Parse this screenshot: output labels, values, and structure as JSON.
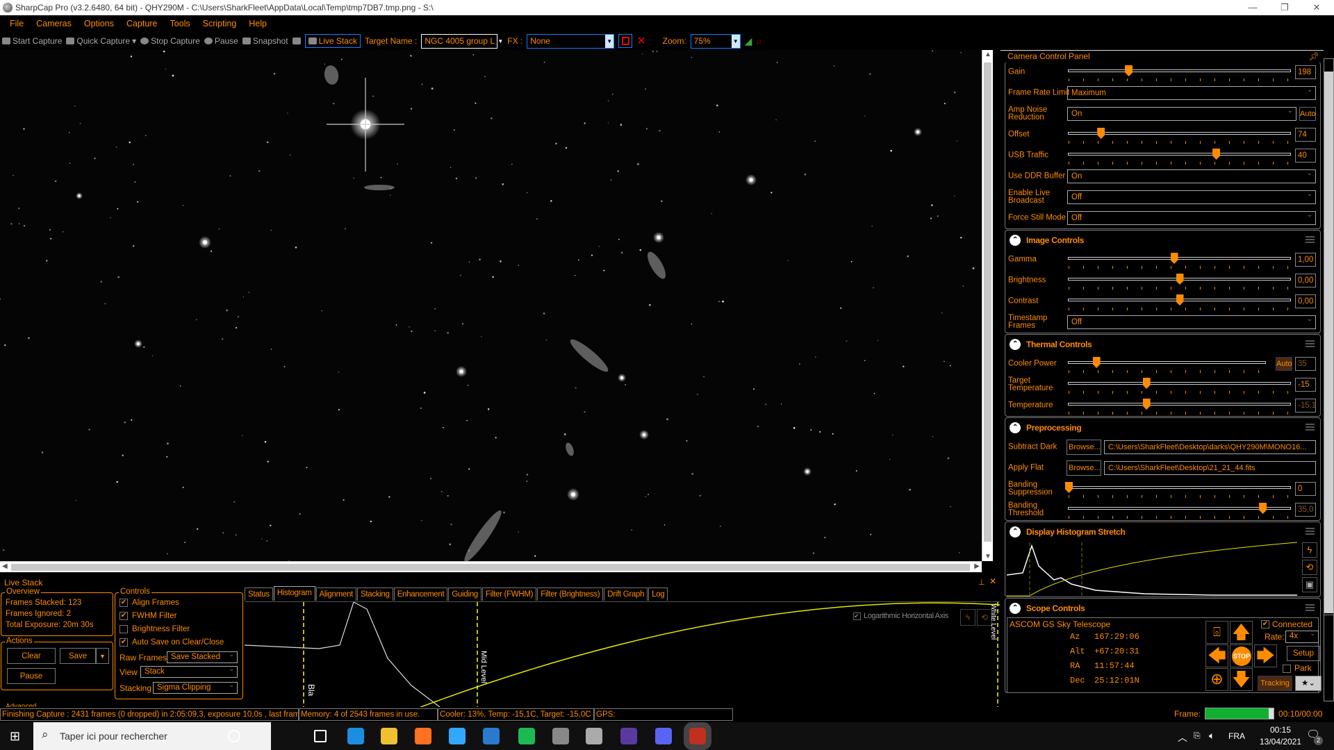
{
  "window": {
    "title": "SharpCap Pro (v3.2.6480, 64 bit) - QHY290M - C:\\Users\\SharkFleet\\AppData\\Local\\Temp\\tmp7DB7.tmp.png - S:\\",
    "min": "—",
    "max": "❐",
    "close": "✕"
  },
  "menu": [
    "File",
    "Cameras",
    "Options",
    "Capture",
    "Tools",
    "Scripting",
    "Help"
  ],
  "toolbar": {
    "start_capture": "Start Capture",
    "quick_capture": "Quick Capture",
    "stop_capture": "Stop Capture",
    "pause": "Pause",
    "snapshot": "Snapshot",
    "live_stack": "Live Stack",
    "target_label": "Target Name :",
    "target_value": "NGC 4005 group L",
    "fx_label": "FX :",
    "fx_value": "None",
    "zoom_label": "Zoom:",
    "zoom_value": "75%"
  },
  "camera_panel": {
    "title": "Camera Control Panel",
    "rows": [
      {
        "type": "slider",
        "label": "Gain",
        "value": "198",
        "pos": 0.27
      },
      {
        "type": "select",
        "label": "Frame Rate Limit",
        "value": "Maximum"
      },
      {
        "type": "select",
        "label": "Amp Noise Reduction",
        "value": "On",
        "extra": "Auto"
      },
      {
        "type": "slider",
        "label": "Offset",
        "value": "74",
        "pos": 0.145
      },
      {
        "type": "slider",
        "label": "USB Traffic",
        "value": "40",
        "pos": 0.665
      },
      {
        "type": "select",
        "label": "Use DDR Buffer",
        "value": "On"
      },
      {
        "type": "select",
        "label": "Enable Live Broadcast",
        "value": "Off"
      },
      {
        "type": "select",
        "label": "Force Still Mode",
        "value": "Off"
      }
    ]
  },
  "image_controls": {
    "title": "Image Controls",
    "rows": [
      {
        "type": "slider",
        "label": "Gamma",
        "value": "1,00",
        "pos": 0.475
      },
      {
        "type": "slider",
        "label": "Brightness",
        "value": "0,00",
        "pos": 0.5
      },
      {
        "type": "slider",
        "label": "Contrast",
        "value": "0,00",
        "pos": 0.5
      },
      {
        "type": "select",
        "label": "Timestamp Frames",
        "value": "Off"
      }
    ]
  },
  "thermal_controls": {
    "title": "Thermal Controls",
    "rows": [
      {
        "type": "slider",
        "label": "Cooler Power",
        "value": "35",
        "pos": 0.14,
        "dim": true,
        "extra": "Auto"
      },
      {
        "type": "slider",
        "label": "Target Temperature",
        "value": "-15",
        "pos": 0.35
      },
      {
        "type": "slider",
        "label": "Temperature",
        "value": "-15,1",
        "pos": 0.35,
        "dim": true
      }
    ]
  },
  "preprocessing": {
    "title": "Preprocessing",
    "rows": [
      {
        "type": "file",
        "label": "Subtract Dark",
        "button": "Browse...",
        "value": "C:\\Users\\SharkFleet\\Desktop\\darks\\QHY290M\\MONO16..."
      },
      {
        "type": "file",
        "label": "Apply Flat",
        "button": "Browse...",
        "value": "C:\\Users\\SharkFleet\\Desktop\\21_21_44.fits"
      },
      {
        "type": "slider",
        "label": "Banding Suppression",
        "value": "0",
        "pos": 0.0
      },
      {
        "type": "slider",
        "label": "Banding Threshold",
        "value": "35,0",
        "pos": 0.875,
        "dim": true
      }
    ]
  },
  "display_histogram": {
    "title": "Display Histogram Stretch",
    "icons": [
      "lightning-icon",
      "reset-icon",
      "save-icon"
    ]
  },
  "scope_controls": {
    "title": "Scope Controls",
    "telescope": "ASCOM GS Sky Telescope",
    "connected_label": "Connected",
    "connected": true,
    "coords": [
      {
        "label": "Az",
        "value": "167:29:06"
      },
      {
        "label": "Alt",
        "value": "+67:20:31"
      },
      {
        "label": "RA",
        "value": "11:57:44"
      },
      {
        "label": "Dec",
        "value": "25:12:01N"
      }
    ],
    "rate_label": "Rate:",
    "rate_value": "4x",
    "setup": "Setup",
    "park": "Park",
    "stop": "STOP",
    "tracking": "Tracking"
  },
  "live_stack": {
    "title": "Live Stack",
    "overview": {
      "title": "Overview",
      "frames_stacked": "Frames Stacked:  123",
      "frames_ignored": "Frames Ignored:  2",
      "total_exposure": "Total Exposure:   20m 30s"
    },
    "actions": {
      "title": "Actions",
      "clear": "Clear",
      "save": "Save",
      "pause": "Pause"
    },
    "advanced": "Advanced",
    "controls": {
      "title": "Controls",
      "checks": [
        {
          "label": "Align Frames",
          "checked": true
        },
        {
          "label": "FWHM Filter",
          "checked": true
        },
        {
          "label": "Brightness Filter",
          "checked": false
        },
        {
          "label": "Auto Save on Clear/Close",
          "checked": true
        }
      ],
      "raw_frames_label": "Raw Frames",
      "raw_frames_value": "Save Stacked",
      "view_label": "View",
      "view_value": "Stack",
      "stacking_label": "Stacking",
      "stacking_value": "Sigma Clipping"
    },
    "tabs": [
      "Status",
      "Histogram",
      "Alignment",
      "Stacking",
      "Enhancement",
      "Guiding",
      "Filter (FWHM)",
      "Filter (Brightness)",
      "Drift Graph",
      "Log"
    ],
    "active_tab": "Histogram",
    "histogram": {
      "log_axis_label": "Logarithmic Horizontal Axis",
      "log_axis": true,
      "black_label": "Bla",
      "mid_label": "Mid Level",
      "white_label": "White Level"
    }
  },
  "status_bar": [
    "Finishing Capture : 2431 frames (0 dropped) in 2:05:09,3, exposure 10,0s , last fram",
    "Memory: 4 of 2543 frames in use.",
    "Cooler: 13%, Temp: -15,1C, Target: -15,0C",
    "GPS:"
  ],
  "frame": {
    "label": "Frame:",
    "progress": 0.93,
    "time": "00:10/00:00"
  },
  "taskbar": {
    "search_placeholder": "Taper ici pour rechercher",
    "apps": [
      "cortana",
      "task-view",
      "mail",
      "file-explorer",
      "firefox",
      "photoshop",
      "photos",
      "spotify",
      "app-planet",
      "app-moon",
      "app-stellarium",
      "discord",
      "sharpcap"
    ],
    "language": "FRA",
    "time": "00:15",
    "date": "13/04/2021",
    "notifications": "2"
  },
  "colors": {
    "accent": "#ff8c00",
    "background": "#000000",
    "progress": "#10b030",
    "curve": "#e6e600"
  }
}
